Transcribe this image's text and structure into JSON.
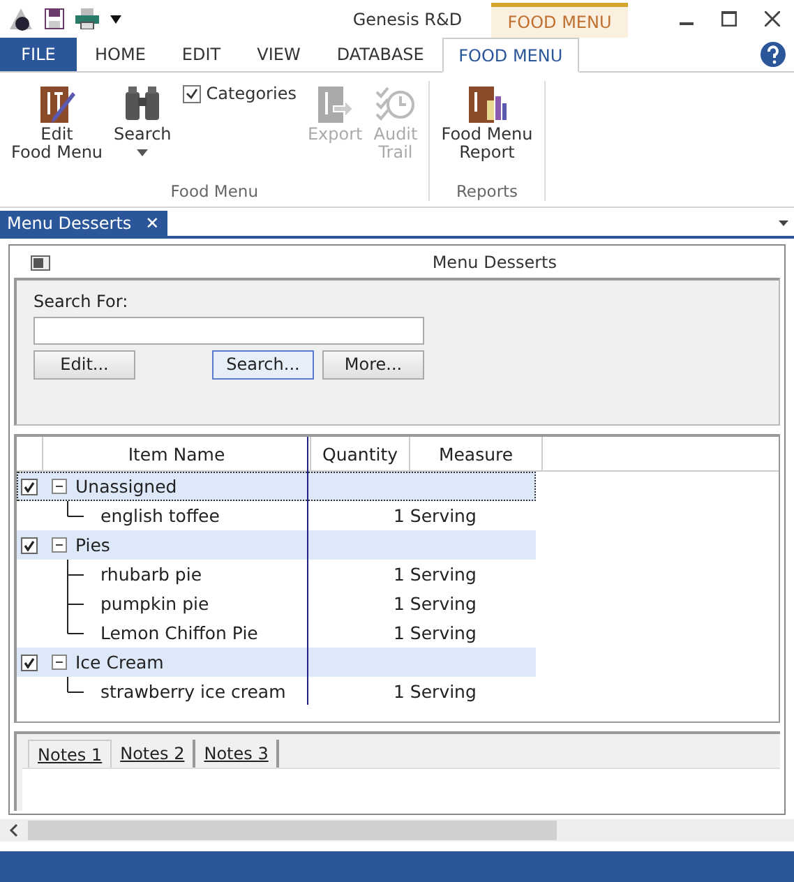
{
  "window": {
    "title": "Genesis R&D",
    "context_tab": "FOOD MENU"
  },
  "ribbon_tabs": [
    {
      "label": "FILE",
      "kind": "file",
      "selected": false
    },
    {
      "label": "HOME",
      "kind": "tab",
      "selected": false
    },
    {
      "label": "EDIT",
      "kind": "tab",
      "selected": false
    },
    {
      "label": "VIEW",
      "kind": "tab",
      "selected": false
    },
    {
      "label": "DATABASE",
      "kind": "tab",
      "selected": false
    },
    {
      "label": "FOOD MENU",
      "kind": "tab",
      "selected": true
    }
  ],
  "ribbon_groups": [
    {
      "label": "Food Menu",
      "items": [
        {
          "kind": "large",
          "label": "Edit\nFood Menu",
          "disabled": false
        },
        {
          "kind": "dropdown",
          "label": "Search",
          "disabled": false
        },
        {
          "kind": "checkbox",
          "label": "Categories",
          "checked": true
        },
        {
          "kind": "large",
          "label": "Export",
          "disabled": true
        },
        {
          "kind": "large",
          "label": "Audit\nTrail",
          "disabled": true
        }
      ]
    },
    {
      "label": "Reports",
      "items": [
        {
          "kind": "large",
          "label": "Food Menu\nReport",
          "disabled": false
        }
      ]
    }
  ],
  "document_tab": {
    "label": "Menu Desserts",
    "close": "✕"
  },
  "panel": {
    "title_prefix": "Menu",
    "title": "Desserts",
    "search": {
      "label": "Search For:",
      "buttons": [
        {
          "label": "Edit...",
          "selected": false
        },
        {
          "label": "Search...",
          "selected": true
        },
        {
          "label": "More...",
          "selected": false
        }
      ]
    },
    "table": {
      "columns": [
        "Item Name",
        "Quantity",
        "Measure"
      ],
      "groups": [
        {
          "name": "Unassigned",
          "checked": true,
          "expanded": true,
          "selected": true,
          "rows": [
            {
              "item": "english toffee",
              "measure": "1 Serving"
            }
          ]
        },
        {
          "name": "Pies",
          "checked": true,
          "expanded": true,
          "selected": false,
          "rows": [
            {
              "item": "rhubarb pie",
              "measure": "1 Serving"
            },
            {
              "item": "pumpkin pie",
              "measure": "1 Serving"
            },
            {
              "item": "Lemon Chiffon Pie",
              "measure": "1 Serving"
            }
          ]
        },
        {
          "name": "Ice Cream",
          "checked": true,
          "expanded": true,
          "selected": false,
          "rows": [
            {
              "item": "strawberry ice cream",
              "measure": "1 Serving"
            }
          ]
        }
      ]
    },
    "notes_tabs": [
      {
        "label": "Notes 1",
        "selected": true
      },
      {
        "label": "Notes 2",
        "selected": false
      },
      {
        "label": "Notes 3",
        "selected": false
      }
    ]
  }
}
